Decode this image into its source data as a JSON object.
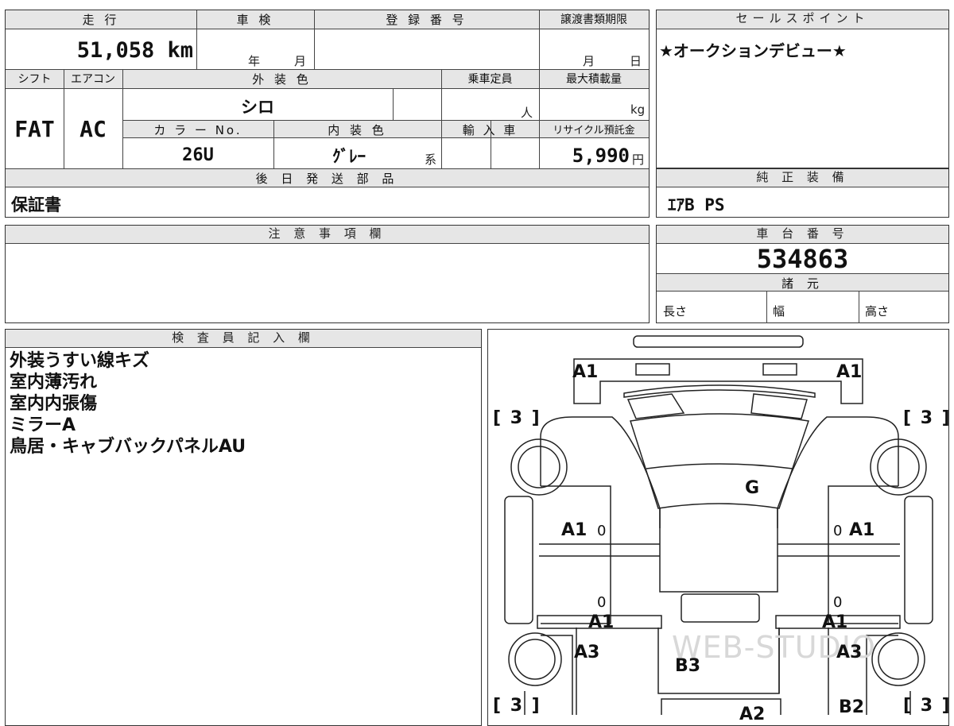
{
  "top_table": {
    "mileage_label": "走 行",
    "mileage_value": "51,058 km",
    "inspection_label": "車 検",
    "inspection_year_unit": "年",
    "inspection_month_unit": "月",
    "registration_label": "登 録 番 号",
    "transfer_deadline_label": "譲渡書類期限",
    "transfer_month_unit": "月",
    "transfer_day_unit": "日",
    "shift_label": "シフト",
    "shift_value": "FAT",
    "aircon_label": "エアコン",
    "aircon_value": "AC",
    "exterior_color_label": "外 装 色",
    "exterior_color_value": "シロ",
    "capacity_label": "乗車定員",
    "capacity_unit": "人",
    "max_load_label": "最大積載量",
    "max_load_unit": "kg",
    "color_no_label": "カ ラ ー No.",
    "color_no_value": "26U",
    "interior_color_label": "内 装 色",
    "interior_color_value": "ｸﾞﾚｰ",
    "interior_color_unit": "系",
    "import_label": "輸 入 車",
    "recycle_label": "リサイクル預託金",
    "recycle_value": "5,990",
    "recycle_unit": "円",
    "later_parts_label": "後 日 発 送 部 品",
    "later_parts_value": "保証書"
  },
  "sales_point": {
    "label": "セールスポイント",
    "value": "★オークションデビュー★"
  },
  "genuine_equipment": {
    "label": "純 正 装 備",
    "value": "ｴｱB PS"
  },
  "caution": {
    "label": "注 意 事 項 欄"
  },
  "chassis": {
    "label": "車 台 番 号",
    "value": "534863"
  },
  "specs": {
    "label": "諸 元",
    "length_label": "長さ",
    "width_label": "幅",
    "height_label": "高さ"
  },
  "inspector": {
    "label": "検 査 員 記 入 欄",
    "notes": [
      "外装うすい線キズ",
      "室内薄汚れ",
      "室内内張傷",
      "ミラーA",
      "鳥居・キャブバックパネルAU"
    ]
  },
  "diagram": {
    "marks": {
      "front_left": "A1",
      "front_right": "A1",
      "bracket_top_left": "[ 3 ]",
      "bracket_top_right": "[ 3 ]",
      "windshield": "G",
      "left_door": "A1",
      "right_door": "A1",
      "zero_left_top": "0",
      "zero_right_top": "0",
      "zero_left_mid": "0",
      "zero_right_mid": "0",
      "left_lower": "A1",
      "right_lower": "A1",
      "left_rear": "A3",
      "right_rear": "A3",
      "bed": "B3",
      "bracket_bottom_left": "[ 3 ]",
      "bracket_bottom_right": "[ 3 ]",
      "bottom_center": "A2",
      "bottom_right": "B2"
    },
    "watermark": "WEB-STUDIO"
  }
}
